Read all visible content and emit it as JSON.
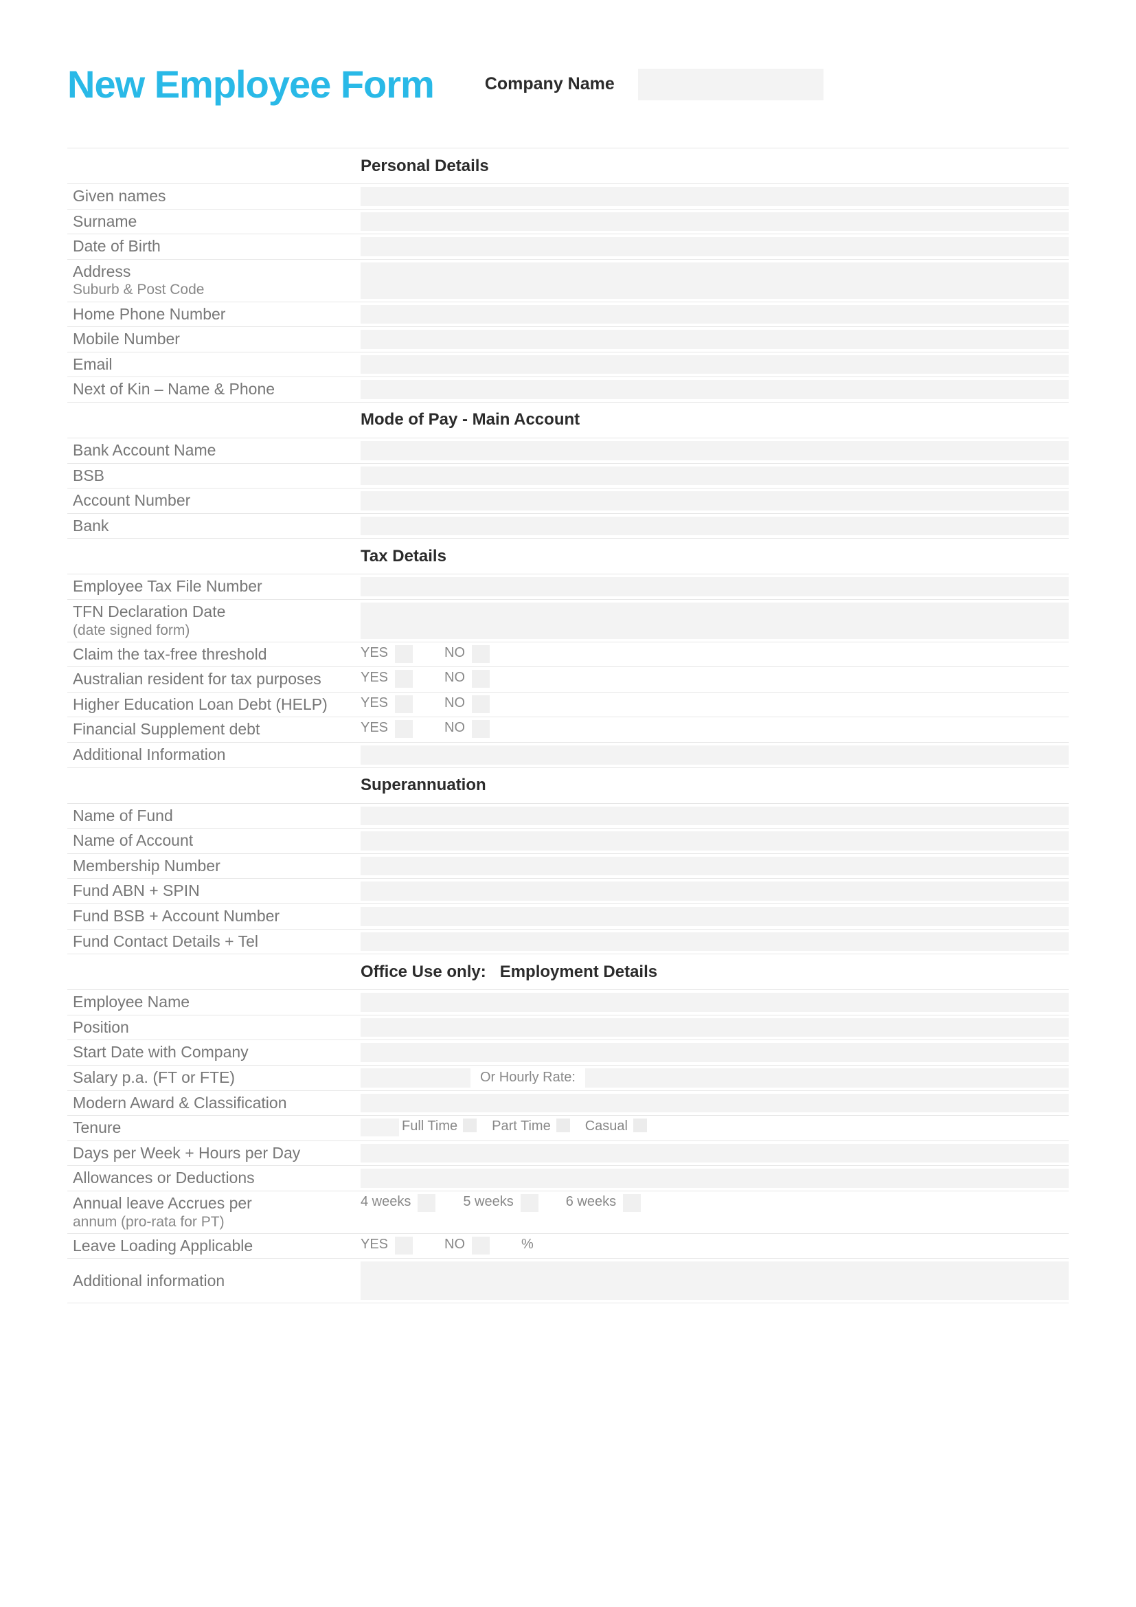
{
  "title": "New Employee Form",
  "company_label": "Company Name",
  "sections": {
    "personal": "Personal Details",
    "pay": "Mode of Pay - Main Account",
    "tax": "Tax Details",
    "super": "Superannuation",
    "office": "Office Use only:   Employment Details"
  },
  "personal": {
    "given_names": "Given names",
    "surname": "Surname",
    "dob": "Date of Birth",
    "address": "Address",
    "address2": "Suburb & Post Code",
    "home_phone": "Home Phone Number",
    "mobile": "Mobile Number",
    "email": "Email",
    "nok": "Next of Kin – Name & Phone"
  },
  "pay": {
    "acct_name": "Bank Account Name",
    "bsb": "BSB",
    "acct_no": "Account Number",
    "bank": "Bank"
  },
  "tax": {
    "tfn": "Employee Tax File Number",
    "tfn_date": "TFN Declaration Date",
    "tfn_date2": "(date signed form)",
    "threshold": "Claim the tax-free threshold",
    "resident": "Australian resident for tax purposes",
    "help": "Higher Education Loan Debt (HELP)",
    "fsd": "Financial Supplement debt",
    "addl": "Additional Information",
    "yes": "YES",
    "no": "NO"
  },
  "super": {
    "fund": "Name of Fund",
    "account": "Name of Account",
    "member": "Membership Number",
    "abn": "Fund ABN  + SPIN",
    "bsb": "Fund BSB +  Account Number",
    "contact": "Fund Contact Details + Tel"
  },
  "office": {
    "emp_name": "Employee Name",
    "position": "Position",
    "start": "Start Date with Company",
    "salary": "Salary p.a. (FT or FTE)",
    "hourly": "Or Hourly Rate:",
    "award": "Modern Award & Classification",
    "tenure": "Tenure",
    "ft": "Full Time",
    "pt": "Part Time",
    "casual": "Casual",
    "days": "Days per Week + Hours per Day",
    "allow": "Allowances or Deductions",
    "leave": "Annual leave Accrues per",
    "leave2": "annum (pro-rata for PT)",
    "w4": "4 weeks",
    "w5": "5 weeks",
    "w6": "6 weeks",
    "loading": "Leave Loading Applicable",
    "pct": "%",
    "addl": "Additional information"
  }
}
